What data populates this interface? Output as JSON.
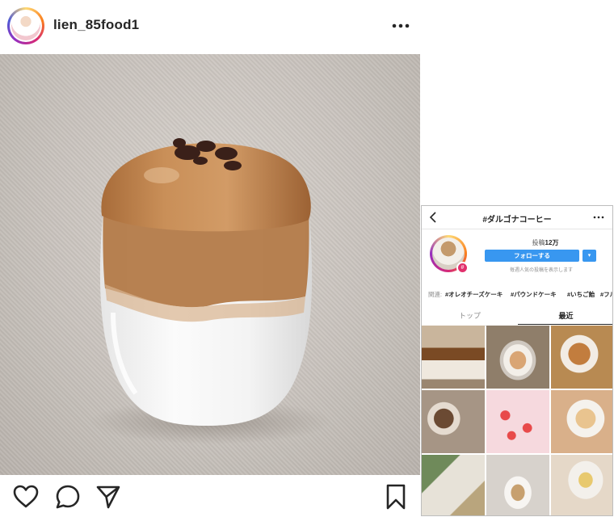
{
  "post": {
    "username": "lien_85food1"
  },
  "panel": {
    "hashtag": "#ダルゴナコーヒー",
    "posts_label": "投稿",
    "posts_count": "12万",
    "follow_label": "フォローする",
    "follow_note": "毎週人気の投稿を表示します",
    "related_label": "関連:",
    "related_tags": [
      "#オレオチーズケーキ",
      "#パウンドケーキ",
      "#いちご飴",
      "#フル"
    ],
    "tabs": [
      "トップ",
      "最近"
    ],
    "active_tab": "最近"
  },
  "icons": {
    "more": "more-horizontal-icon",
    "like": "heart-icon",
    "comment": "comment-icon",
    "share": "paper-plane-icon",
    "save": "bookmark-icon",
    "back": "chevron-left-icon"
  },
  "colors": {
    "follow_button": "#3897f0",
    "text": "#262626",
    "muted": "#8e8e8e"
  }
}
